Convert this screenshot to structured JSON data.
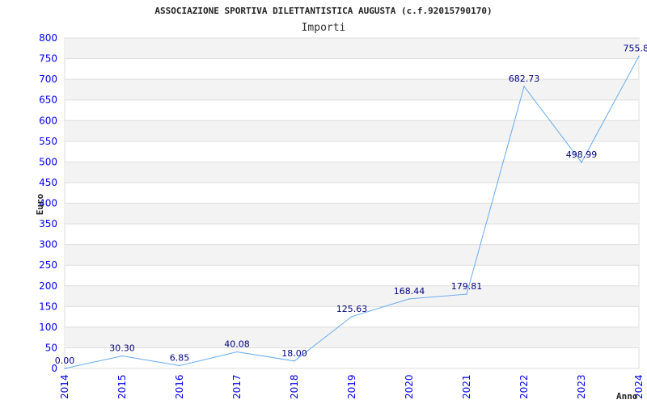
{
  "chart_data": {
    "type": "line",
    "title": "ASSOCIAZIONE SPORTIVA DILETTANTISTICA AUGUSTA (c.f.92015790170)",
    "subtitle": "Importi",
    "xlabel": "Anno",
    "ylabel": "Euro",
    "ylim": [
      0,
      800
    ],
    "yticks": [
      0,
      50,
      100,
      150,
      200,
      250,
      300,
      350,
      400,
      450,
      500,
      550,
      600,
      650,
      700,
      750,
      800
    ],
    "categories": [
      "2014",
      "2015",
      "2016",
      "2017",
      "2018",
      "2019",
      "2020",
      "2021",
      "2022",
      "2023",
      "2024"
    ],
    "values": [
      0.0,
      30.3,
      6.85,
      40.08,
      18.0,
      125.63,
      168.44,
      179.81,
      682.73,
      498.99,
      755.8
    ],
    "data_labels": [
      "0.00",
      "30.30",
      "6.85",
      "40.08",
      "18.00",
      "125.63",
      "168.44",
      "179.81",
      "682.73",
      "498.99",
      "755.8"
    ],
    "grid": true,
    "colors": {
      "line": "#66aaee",
      "band": "#f3f3f3",
      "tick": "#0000ee",
      "label": "#000080"
    }
  }
}
